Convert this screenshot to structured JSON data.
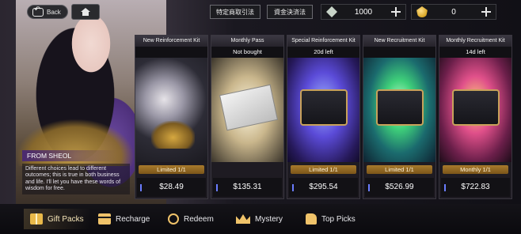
{
  "topbar": {
    "back_label": "Back",
    "link_button_1": "特定商取引法",
    "link_button_2": "資金決済法",
    "currency_1_value": "1000",
    "currency_2_value": "0"
  },
  "story": {
    "title": "FROM SHEOL",
    "text": "Different choices lead to different outcomes; this is true in both business and life. I'll let you have these words of wisdom for free."
  },
  "cards": [
    {
      "title": "New Reinforcement Kit",
      "sub": "",
      "limit": "Limited 1/1",
      "price": "$28.49"
    },
    {
      "title": "Monthly Pass",
      "sub": "Not bought",
      "limit": "",
      "price": "$135.31"
    },
    {
      "title": "Special Reinforcement Kit",
      "sub": "20d left",
      "limit": "Limited 1/1",
      "price": "$295.54"
    },
    {
      "title": "New Recruitment Kit",
      "sub": "",
      "limit": "Limited 1/1",
      "price": "$526.99"
    },
    {
      "title": "Monthly Recruitment Kit",
      "sub": "14d left",
      "limit": "Monthly 1/1",
      "price": "$722.83"
    }
  ],
  "nav": {
    "gift_packs": "Gift Packs",
    "recharge": "Recharge",
    "redeem": "Redeem",
    "mystery": "Mystery",
    "top_picks": "Top Picks"
  },
  "icons": [
    "back-icon",
    "home-icon",
    "diamond-icon",
    "coin-icon",
    "plus-icon",
    "gift-icon",
    "card-icon",
    "redeem-icon",
    "crown-icon",
    "thumbs-up-icon"
  ],
  "colors": {
    "accent_gold": "#a87a2c",
    "active_nav": "#f6e6b8",
    "story_title_bg": "#4a2a70"
  }
}
